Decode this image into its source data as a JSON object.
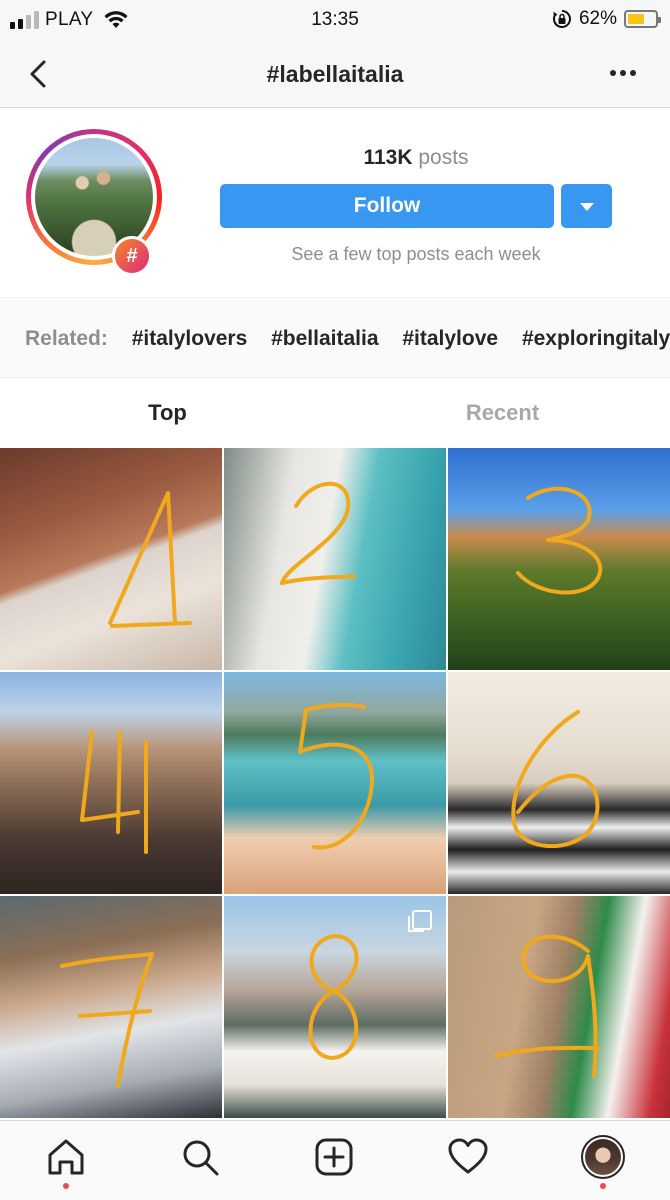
{
  "status_bar": {
    "carrier": "PLAY",
    "time": "13:35",
    "battery_percent": "62%",
    "battery_level": 0.62,
    "battery_color": "#f5c518",
    "signal_bars": 4,
    "signal_active": 2
  },
  "nav": {
    "title": "#labellaitalia",
    "back_icon": "chevron-left-icon",
    "more_icon": "more-horizontal-icon"
  },
  "header": {
    "posts_count": "113K",
    "posts_word": "posts",
    "follow_label": "Follow",
    "subtitle": "See a few top posts each week",
    "badge_symbol": "#",
    "accent_color": "#3897f0"
  },
  "related": {
    "label": "Related:",
    "tags": [
      "#italylovers",
      "#bellaitalia",
      "#italylove",
      "#exploringitaly"
    ]
  },
  "tabs": {
    "top": "Top",
    "recent": "Recent",
    "active": "Top"
  },
  "grid": {
    "annotation_color": "#f0a81c",
    "posts": [
      {
        "number": "1",
        "subject": "brick building and palace",
        "multi": false
      },
      {
        "number": "2",
        "subject": "woman in white hijab by the sea",
        "multi": false
      },
      {
        "number": "3",
        "subject": "hilltop sanctuary above forest",
        "multi": false
      },
      {
        "number": "4",
        "subject": "woman in leopard dress near castle",
        "multi": false
      },
      {
        "number": "5",
        "subject": "woman at turquoise lake",
        "multi": false
      },
      {
        "number": "6",
        "subject": "woman in checkered marble hall",
        "multi": false
      },
      {
        "number": "7",
        "subject": "man in grey sweater",
        "multi": false
      },
      {
        "number": "8",
        "subject": "woman at canal bridge",
        "multi": true
      },
      {
        "number": "9",
        "subject": "colosseum with italian flag",
        "multi": false
      }
    ]
  },
  "tabbar": {
    "items": [
      "home-icon",
      "search-icon",
      "new-post-icon",
      "activity-heart-icon",
      "profile-avatar"
    ]
  }
}
